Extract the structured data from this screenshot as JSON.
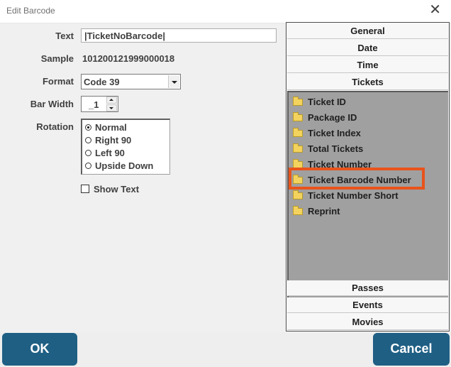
{
  "window": {
    "title": "Edit Barcode",
    "close_icon": "close-icon"
  },
  "form": {
    "text_label": "Text",
    "text_value": "|TicketNoBarcode|",
    "sample_label": "Sample",
    "sample_value": "101200121999000018",
    "format_label": "Format",
    "format_value": "Code 39",
    "bar_width_label": "Bar Width",
    "bar_width_value": "_1",
    "rotation_label": "Rotation",
    "rotation_options": [
      "Normal",
      "Right 90",
      "Left 90",
      "Upside Down"
    ],
    "rotation_selected": "Normal",
    "show_text_label": "Show Text",
    "show_text_checked": false
  },
  "panel": {
    "tabs_top": [
      "General",
      "Date",
      "Time",
      "Tickets"
    ],
    "active_tab": "Tickets",
    "items": [
      "Ticket ID",
      "Package ID",
      "Ticket Index",
      "Total Tickets",
      "Ticket Number",
      "Ticket Barcode Number",
      "Ticket Number Short",
      "Reprint"
    ],
    "highlighted_item": "Ticket Barcode Number",
    "tabs_bottom": [
      "Passes",
      "Events",
      "Movies"
    ]
  },
  "buttons": {
    "ok_label": "OK",
    "cancel_label": "Cancel"
  },
  "colors": {
    "button_bg": "#1f5f84",
    "highlight": "#e8541c",
    "list_bg": "#a0a0a0",
    "folder": "#f3d35d"
  }
}
